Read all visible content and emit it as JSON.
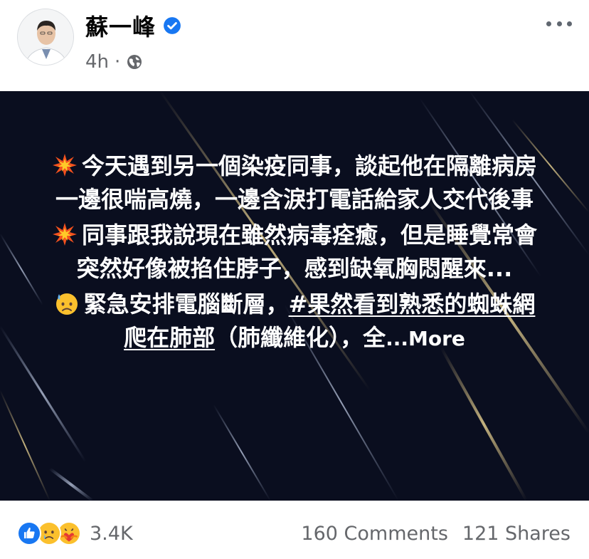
{
  "header": {
    "author_name": "蘇一峰",
    "time": "4h",
    "dot": "·"
  },
  "post": {
    "p1": "今天遇到另一個染疫同事，談起他在隔離病房一邊很喘高燒，一邊含淚打電話給家人交代後事",
    "p2": "同事跟我說現在雖然病毒痊癒，但是睡覺常會突然好像被掐住脖子，感到缺氧胸悶醒來...",
    "p3_lead": "緊急安排電腦斷層，",
    "p3_hashtag": "#果然看到熟悉的蜘蛛網爬在肺部",
    "p3_tail": "（肺纖維化），全",
    "more_label": "...More"
  },
  "footer": {
    "reaction_count": "3.4K",
    "comments": "160 Comments",
    "shares": "121 Shares"
  },
  "colors": {
    "image_bg": "#0a0e1f",
    "like_blue": "#1877f2",
    "meta_gray": "#65676b"
  }
}
